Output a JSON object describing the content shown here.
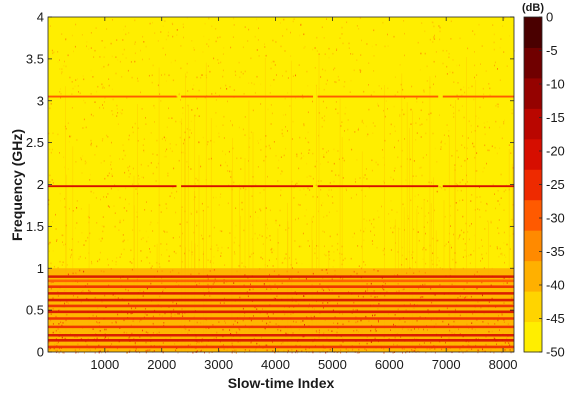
{
  "chart_data": {
    "type": "heatmap",
    "title": "",
    "xlabel": "Slow-time Index",
    "ylabel": "Frequency (GHz)",
    "xlim": [
      1,
      8192
    ],
    "ylim": [
      0,
      4
    ],
    "x_ticks": [
      1000,
      2000,
      3000,
      4000,
      5000,
      6000,
      7000,
      8000
    ],
    "y_ticks": [
      0,
      0.5,
      1,
      1.5,
      2,
      2.5,
      3,
      3.5,
      4
    ],
    "colorbar": {
      "unit_label": "(dB)",
      "range": [
        -50,
        0
      ],
      "ticks": [
        0,
        -5,
        -10,
        -15,
        -20,
        -25,
        -30,
        -35,
        -40,
        -45,
        -50
      ],
      "colors": [
        "#ffee00",
        "#ffd400",
        "#ffb000",
        "#ff8a00",
        "#ff5a00",
        "#ee2a00",
        "#d60e00",
        "#b90600",
        "#950200",
        "#700000",
        "#4a0000"
      ]
    },
    "background_level_db": -50,
    "band_lines": [
      {
        "freq_ghz": 3.05,
        "level_db": -28,
        "gaps": [
          2300,
          4700,
          6900
        ]
      },
      {
        "freq_ghz": 1.98,
        "level_db": -18,
        "gaps": [
          2300,
          4700,
          6900
        ]
      },
      {
        "freq_ghz": 0.9,
        "level_db": -22
      },
      {
        "freq_ghz": 0.85,
        "level_db": -30
      },
      {
        "freq_ghz": 0.78,
        "level_db": -26
      },
      {
        "freq_ghz": 0.7,
        "level_db": -20
      },
      {
        "freq_ghz": 0.62,
        "level_db": -22
      },
      {
        "freq_ghz": 0.55,
        "level_db": -24
      },
      {
        "freq_ghz": 0.48,
        "level_db": -20
      },
      {
        "freq_ghz": 0.4,
        "level_db": -24
      },
      {
        "freq_ghz": 0.3,
        "level_db": -26
      },
      {
        "freq_ghz": 0.2,
        "level_db": -22
      },
      {
        "freq_ghz": 0.14,
        "level_db": -20
      },
      {
        "freq_ghz": 0.06,
        "level_db": -24
      }
    ],
    "noisy_region": {
      "from_ghz": 0,
      "to_ghz": 1.0,
      "level_db": -35
    },
    "grid": false
  }
}
